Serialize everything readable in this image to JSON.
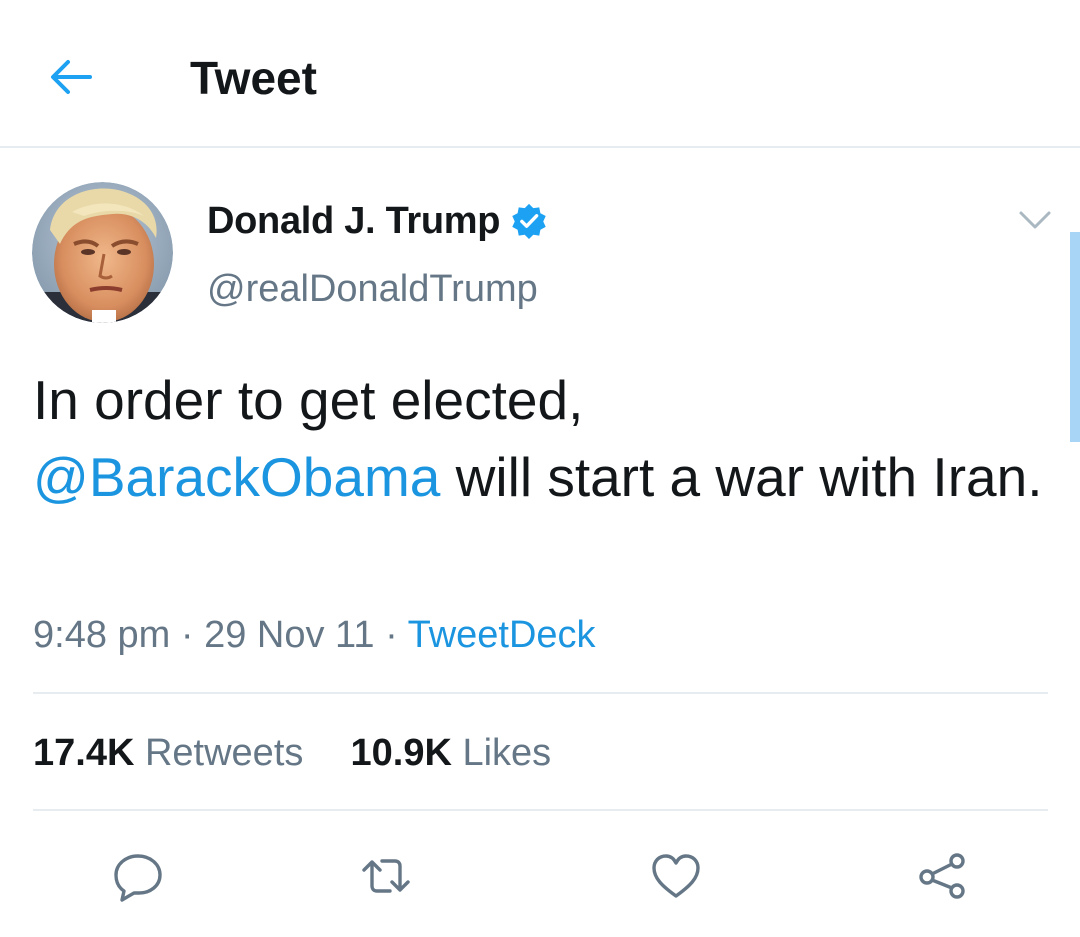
{
  "header": {
    "title": "Tweet",
    "back_icon": "arrow-left-icon"
  },
  "tweet": {
    "author_name": "Donald J. Trump",
    "handle": "@realDonaldTrump",
    "verified_icon": "verified-badge-icon",
    "menu_icon": "chevron-down-icon",
    "text_line1": "In order to get elected,",
    "mention": "@BarackObama",
    "text_rest": " will start a war with Iran.",
    "time": "9:48 pm",
    "separator": "·",
    "date": "29 Nov 11",
    "source": "TweetDeck"
  },
  "stats": {
    "retweets_count": "17.4K",
    "retweets_label": "Retweets",
    "likes_count": "10.9K",
    "likes_label": "Likes"
  },
  "actions": {
    "reply_icon": "reply-icon",
    "retweet_icon": "retweet-icon",
    "like_icon": "heart-icon",
    "share_icon": "share-icon"
  },
  "colors": {
    "accent": "#1b95e0",
    "text": "#14171a",
    "secondary": "#657786",
    "divider": "#e6ecf0"
  }
}
